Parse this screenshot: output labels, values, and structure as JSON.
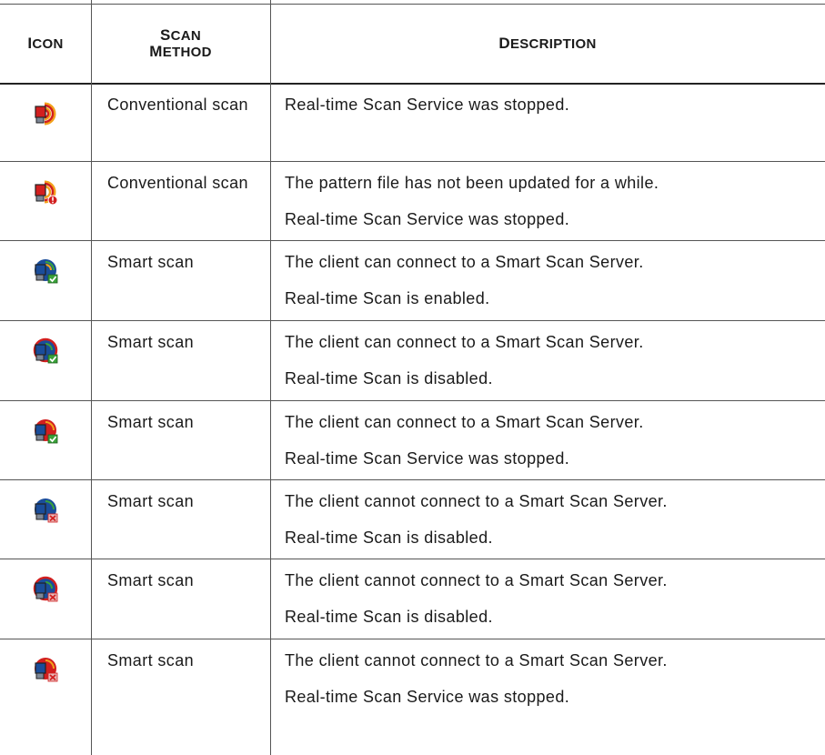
{
  "header": {
    "icon": [
      "I",
      "CON"
    ],
    "scan_method_1": [
      "S",
      "CAN"
    ],
    "scan_method_2": [
      "M",
      "ETHOD"
    ],
    "description": [
      "D",
      "ESCRIPTION"
    ]
  },
  "rows": [
    {
      "icon": "realtime-stopped-icon",
      "method": "Conventional scan",
      "line1": "Real-time Scan Service was stopped.",
      "line2": ""
    },
    {
      "icon": "pattern-outdated-stopped-icon",
      "method": "Conventional scan",
      "line1": "The pattern file has not been updated for a while.",
      "line2": "Real-time Scan Service was stopped."
    },
    {
      "icon": "smart-connected-enabled-icon",
      "method": "Smart scan",
      "line1": "The client can connect to a Smart Scan Server.",
      "line2": "Real-time Scan is enabled."
    },
    {
      "icon": "smart-connected-disabled-icon",
      "method": "Smart scan",
      "line1": "The client can connect to a Smart Scan Server.",
      "line2": "Real-time Scan is disabled."
    },
    {
      "icon": "smart-connected-stopped-icon",
      "method": "Smart scan",
      "line1": "The client can connect to a Smart Scan Server.",
      "line2": "Real-time Scan Service was stopped."
    },
    {
      "icon": "smart-disconnected-disabled-icon",
      "method": "Smart scan",
      "line1": "The client cannot connect to a Smart Scan Server.",
      "line2": "Real-time Scan is disabled."
    },
    {
      "icon": "smart-disconnected-disabled-icon",
      "method": "Smart scan",
      "line1": "The client cannot connect to a Smart Scan Server.",
      "line2": "Real-time Scan is disabled."
    },
    {
      "icon": "smart-disconnected-stopped-icon",
      "method": "Smart scan",
      "line1": "The client cannot connect to a Smart Scan Server.",
      "line2": "Real-time Scan Service was stopped."
    }
  ],
  "colors": {
    "red": "#d21f1f",
    "orange": "#f2a21c",
    "blue": "#1a4d9a",
    "green": "#3aa23a",
    "grey": "#7d8796"
  }
}
